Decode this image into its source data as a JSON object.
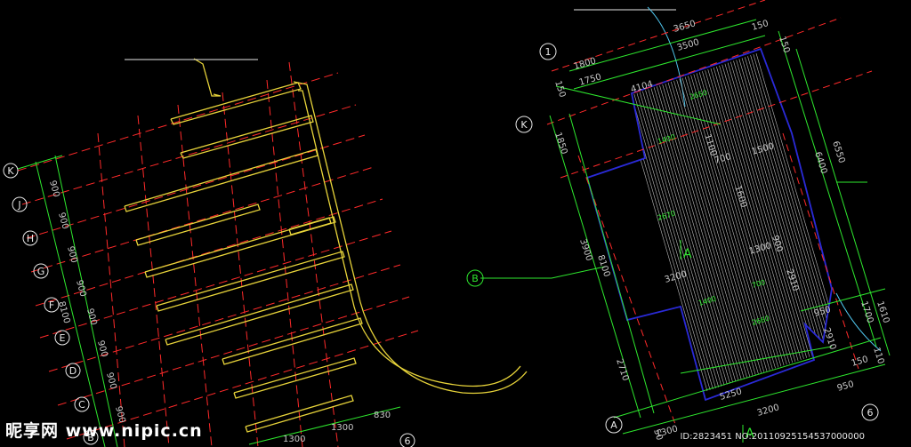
{
  "left_plan": {
    "axis_labels": [
      "K",
      "J",
      "H",
      "G",
      "F",
      "E",
      "D",
      "C",
      "B"
    ],
    "spacing_labels": [
      "900",
      "900",
      "900",
      "900",
      "8100",
      "900",
      "900",
      "900",
      "900"
    ],
    "bottom_dims": [
      "1300",
      "1300",
      "830"
    ],
    "bottom_axis_label": "6"
  },
  "right_plan": {
    "axis_labels": {
      "a1": "1",
      "k": "K",
      "b": "B",
      "a": "A",
      "a6": "6"
    },
    "dims": {
      "d3650": "3650",
      "d3500": "3500",
      "d1800": "1800",
      "d1750": "1750",
      "d150a": "150",
      "d150b": "150",
      "d150c": "150",
      "d1850": "1850",
      "d3900": "3900",
      "d8100": "8100",
      "d2710": "2710",
      "d4104": "4104",
      "d6550": "6550",
      "d6400": "6400",
      "d1500": "1500",
      "d1300": "1300",
      "d3200": "3200",
      "d2910": "2910",
      "d2910b": "2910",
      "d1700": "1700",
      "d1610": "1610",
      "d950": "950",
      "d950b": "950",
      "d5250": "5250",
      "d3200b": "3200",
      "d1300b": "1300",
      "d110": "110",
      "d700": "700",
      "d1600": "1600",
      "d1100": "1100",
      "d900": "900",
      "d50": "50"
    },
    "inner": {
      "i2650": "2650",
      "i2670": "2670",
      "i2660": "2660",
      "i1400": "1400",
      "i700": "700",
      "i1400b": "1400",
      "section_mark": "A"
    }
  },
  "watermark": {
    "logo_text": "昵享网 www.nipic.cn",
    "id_text": "ID:2823451 NO:20110925154537000000"
  },
  "colors": {
    "background": "#000000",
    "grid_red": "#ff2a2a",
    "wall_yellow": "#e8d43a",
    "wall_orange": "#d8782a",
    "dim_green": "#2ee82e",
    "outline_blue": "#2a2ad8",
    "text_white": "#e8e8e8"
  }
}
